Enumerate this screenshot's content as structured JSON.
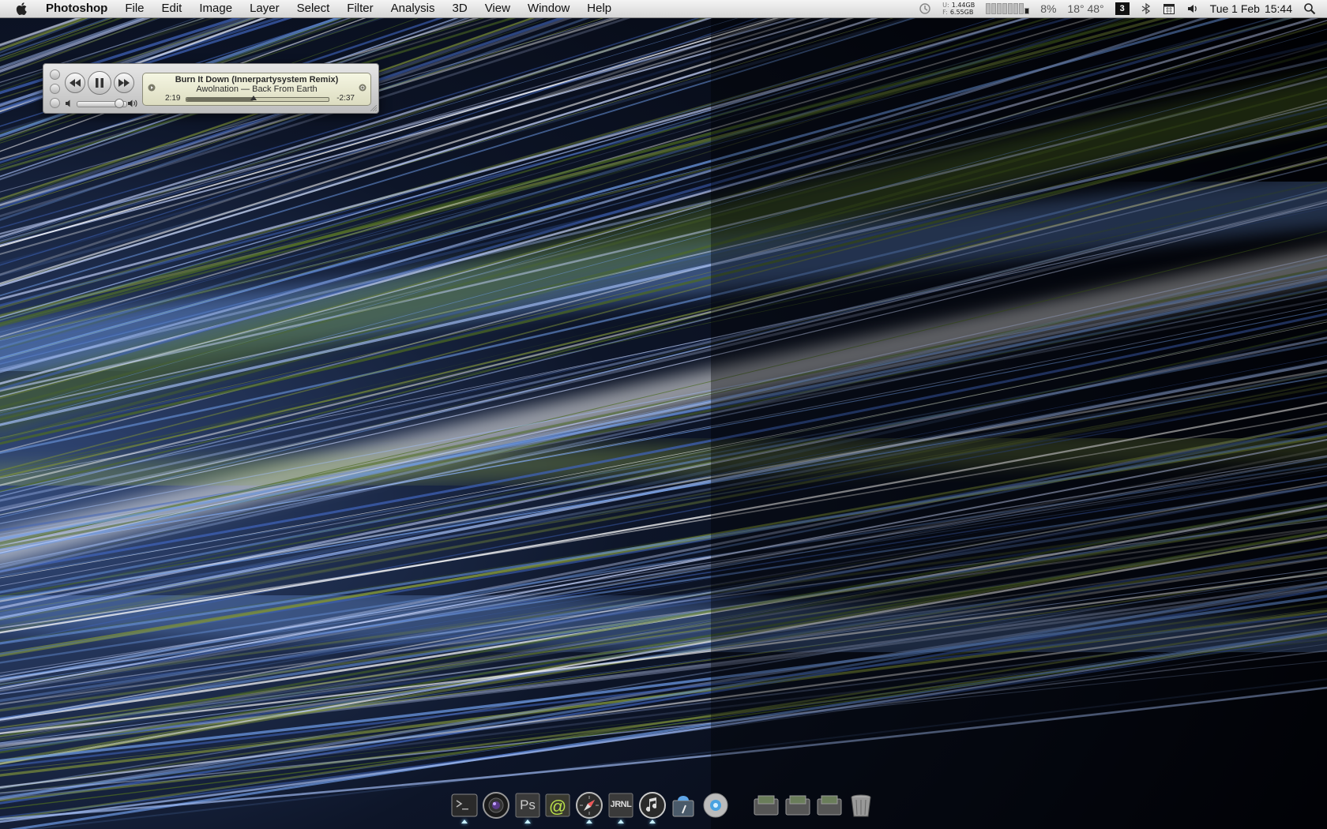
{
  "menubar": {
    "app_name": "Photoshop",
    "items": [
      "File",
      "Edit",
      "Image",
      "Layer",
      "Select",
      "Filter",
      "Analysis",
      "3D",
      "View",
      "Window",
      "Help"
    ],
    "status": {
      "memory_used_label": "U:",
      "memory_used": "1.44GB",
      "memory_free_label": "F:",
      "memory_free": "6.55GB",
      "cpu_percent": "8%",
      "temperature": "18° 48°",
      "spaces_number": "3",
      "date": "Tue 1 Feb",
      "time": "15:44"
    },
    "status_icons": [
      "time-machine-icon",
      "cpu-meter-icon",
      "spaces-icon",
      "bluetooth-icon",
      "calendar-icon",
      "volume-icon",
      "spotlight-icon"
    ]
  },
  "miniplayer": {
    "track_title": "Burn It Down (Innerpartysystem Remix)",
    "artist_album": "Awolnation — Back From Earth",
    "elapsed": "2:19",
    "remaining": "-2:37",
    "progress_fraction": 0.47,
    "volume_fraction": 0.85
  },
  "dock": {
    "apps": [
      {
        "name": "finder-terminal",
        "icon": "terminal-icon",
        "running": true
      },
      {
        "name": "aperture",
        "icon": "aperture-icon",
        "running": false
      },
      {
        "name": "photoshop",
        "icon": "photoshop-icon",
        "running": true,
        "label": "Ps"
      },
      {
        "name": "mail",
        "icon": "mail-icon",
        "running": false
      },
      {
        "name": "safari",
        "icon": "safari-icon",
        "running": true
      },
      {
        "name": "journal",
        "icon": "journal-icon",
        "running": true,
        "label": "JRNL"
      },
      {
        "name": "itunes",
        "icon": "itunes-icon",
        "running": true
      },
      {
        "name": "utility",
        "icon": "script-editor-icon",
        "running": false
      },
      {
        "name": "system-app",
        "icon": "circle-app-icon",
        "running": false
      }
    ],
    "stacks": [
      {
        "name": "stack-1",
        "icon": "drive-stack-icon"
      },
      {
        "name": "stack-2",
        "icon": "drive-stack-icon"
      },
      {
        "name": "stack-3",
        "icon": "drive-stack-icon"
      },
      {
        "name": "trash",
        "icon": "trash-icon"
      }
    ]
  },
  "colors": {
    "menubar_top": "#f4f4f4",
    "menubar_bottom": "#d6d6d6",
    "lcd_bg": "#e8e9d0",
    "wallpaper_blue": "#6e9be6",
    "wallpaper_green": "#4d6b22"
  }
}
